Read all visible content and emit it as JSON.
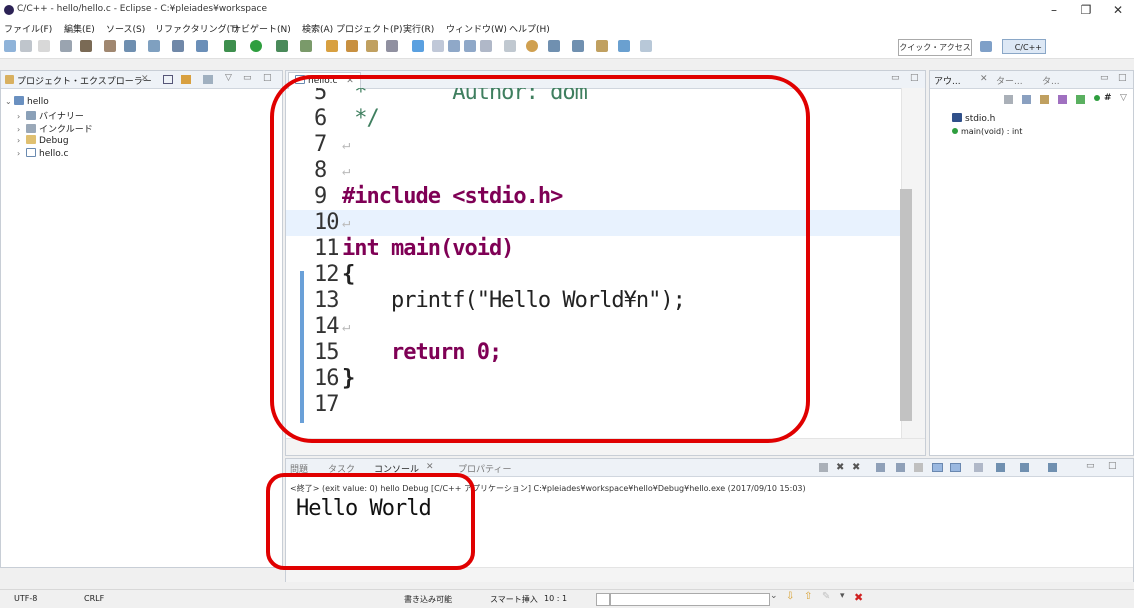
{
  "window": {
    "title": "C/C++ - hello/hello.c - Eclipse - C:¥pleiades¥workspace"
  },
  "menu": [
    "ファイル(F)",
    "編集(E)",
    "ソース(S)",
    "リファクタリング(T)",
    "ナビゲート(N)",
    "検索(A)",
    "プロジェクト(P)",
    "実行(R)",
    "ウィンドウ(W)",
    "ヘルプ(H)"
  ],
  "toolbar": {
    "quick_access": "クイック・アクセス",
    "perspective": "C/C++"
  },
  "explorer": {
    "title": "プロジェクト・エクスプローラー",
    "project": "hello",
    "items": [
      "バイナリー",
      "インクルード",
      "Debug",
      "hello.c"
    ]
  },
  "editor": {
    "tab": "hello.c",
    "lines": [
      {
        "num": "5",
        "text": " *       Author: dom"
      },
      {
        "num": "6",
        "text": " */"
      },
      {
        "num": "7",
        "text": ""
      },
      {
        "num": "8",
        "text": ""
      },
      {
        "num": "9",
        "text": "#include <stdio.h>"
      },
      {
        "num": "10",
        "text": ""
      },
      {
        "num": "11",
        "text": "int main(void)"
      },
      {
        "num": "12",
        "text": "{"
      },
      {
        "num": "13",
        "text": "    printf(\"Hello World¥n\");"
      },
      {
        "num": "14",
        "text": ""
      },
      {
        "num": "15",
        "text": "    return 0;"
      },
      {
        "num": "16",
        "text": "}"
      },
      {
        "num": "17",
        "text": ""
      }
    ]
  },
  "outline": {
    "tabs": [
      "アウ...",
      "ター...",
      "タ..."
    ],
    "items": [
      "stdio.h",
      "main(void) : int"
    ]
  },
  "console": {
    "tabs": [
      "問題",
      "タスク",
      "コンソール",
      "プロパティー"
    ],
    "info": "<終了> (exit value: 0) hello Debug [C/C++ アプリケーション] C:¥pleiades¥workspace¥hello¥Debug¥hello.exe (2017/09/10 15:03)",
    "output": "Hello World"
  },
  "status": {
    "encoding": "UTF-8",
    "line_ending": "CRLF",
    "writable": "書き込み可能",
    "insert_mode": "スマート挿入",
    "position": "10 : 1"
  },
  "colors": {
    "highlight": "#e00000",
    "keyword": "#7f0055",
    "string": "#2a00ff"
  }
}
